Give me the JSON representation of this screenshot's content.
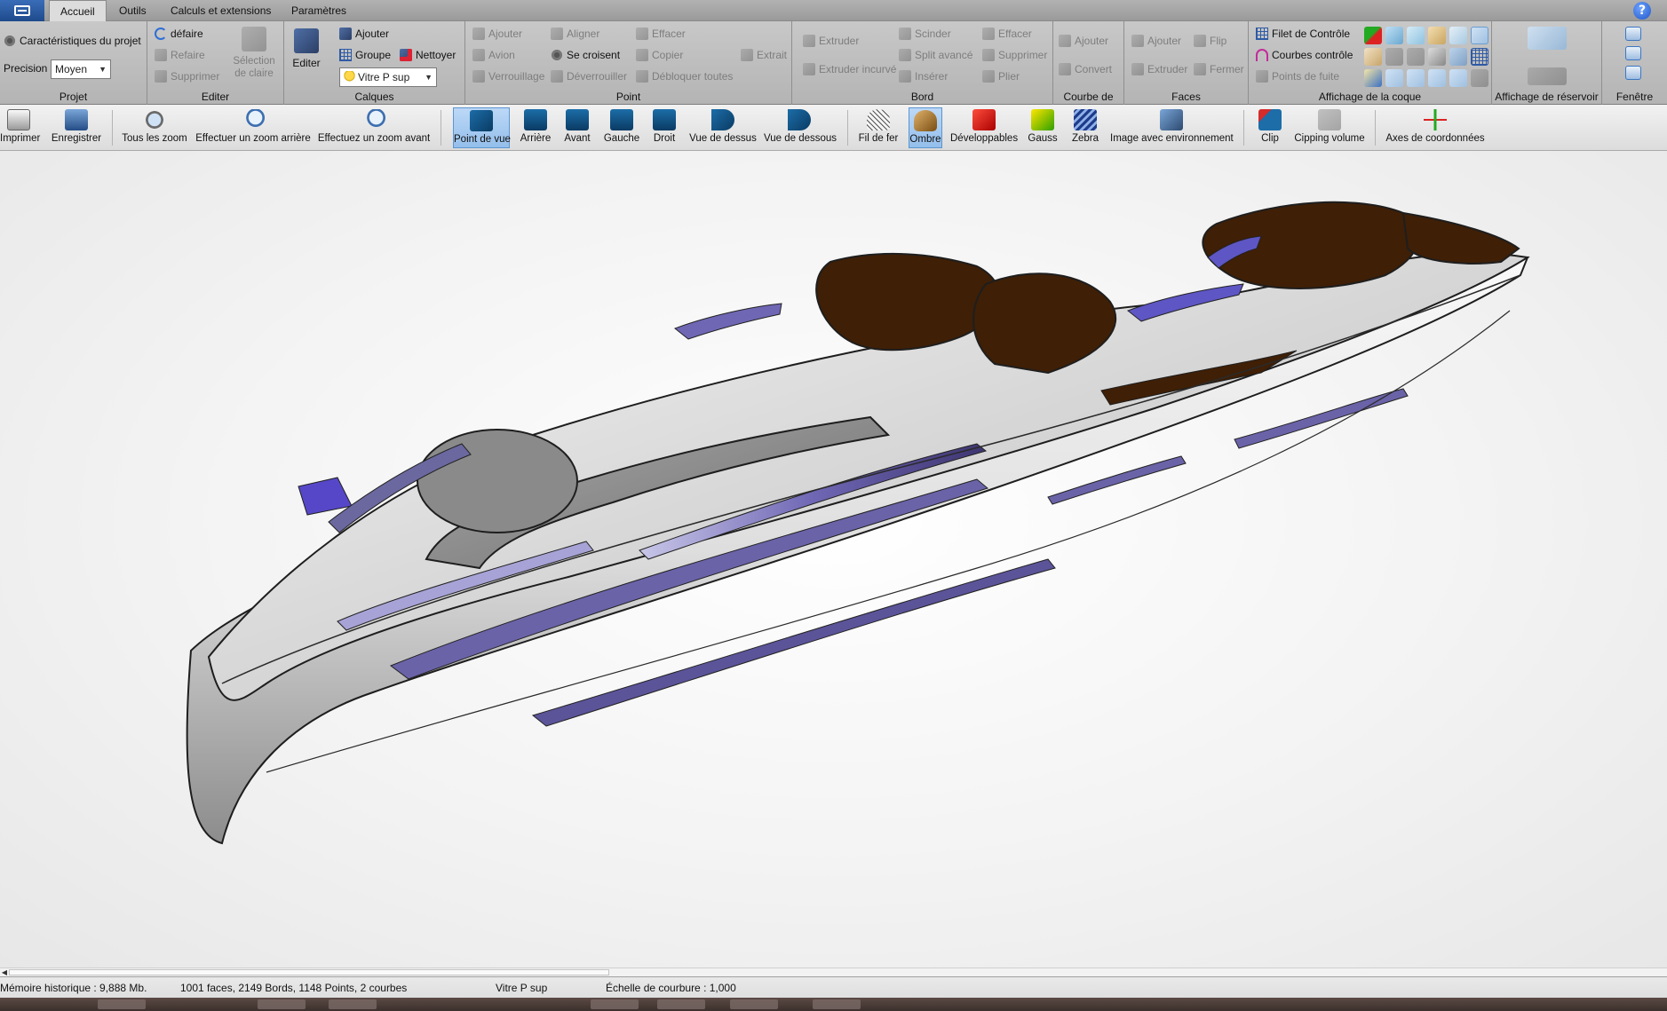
{
  "tabs": [
    "Accueil",
    "Outils",
    "Calculs et extensions",
    "Paramètres"
  ],
  "ribbon": {
    "projet": {
      "title": "Projet",
      "characteristics": "Caractéristiques du projet",
      "precision_label": "Precision",
      "precision_value": "Moyen"
    },
    "editer": {
      "title": "Editer",
      "undo": "défaire",
      "redo": "Refaire",
      "delete": "Supprimer",
      "selection": "Sélection de claire"
    },
    "calques": {
      "title": "Calques",
      "editer": "Editer",
      "ajouter": "Ajouter",
      "groupe": "Groupe",
      "nettoyer": "Nettoyer",
      "layer_value": "Vitre P sup"
    },
    "point": {
      "title": "Point",
      "ajouter": "Ajouter",
      "avion": "Avion",
      "verrouillage": "Verrouillage",
      "aligner": "Aligner",
      "se_croisent": "Se croisent",
      "deverrouiller": "Déverrouiller",
      "effacer": "Effacer",
      "copier": "Copier",
      "debloquer": "Débloquer toutes",
      "extrait": "Extrait"
    },
    "bord": {
      "title": "Bord",
      "extruder": "Extruder",
      "extruder_incurve": "Extruder incurvé",
      "scinder": "Scinder",
      "split_avance": "Split avancé",
      "inserer": "Insérer",
      "effacer": "Effacer",
      "supprimer": "Supprimer",
      "plier": "Plier"
    },
    "courbe": {
      "title": "Courbe de",
      "ajouter": "Ajouter",
      "convert": "Convert"
    },
    "faces": {
      "title": "Faces",
      "ajouter": "Ajouter",
      "extruder": "Extruder",
      "flip": "Flip",
      "fermer": "Fermer"
    },
    "affichage_coque": {
      "title": "Affichage de la coque",
      "filet": "Filet de Contrôle",
      "courbes": "Courbes  contrôle",
      "points": "Points de fuite"
    },
    "affichage_reservoir": {
      "title": "Affichage de réservoir"
    },
    "fenetre": {
      "title": "Fenêtre"
    }
  },
  "toolbar": [
    "Imprimer",
    "Enregistrer",
    "Tous les zoom",
    "Effectuer un zoom arrière",
    "Effectuez un zoom avant",
    "Point de vue",
    "Arrière",
    "Avant",
    "Gauche",
    "Droit",
    "Vue de dessus",
    "Vue de dessous",
    "Fil de fer",
    "Ombre",
    "Développables",
    "Gauss",
    "Zebra",
    "Image avec environnement",
    "Clip",
    "Cipping volume",
    "Axes de coordonnées"
  ],
  "status": {
    "memory": "Mémoire historique : 9,888 Mb.",
    "stats": "1001 faces, 2149 Bords, 1148 Points, 2 courbes",
    "layer": "Vitre P sup",
    "scale": "Échelle de courbure : 1,000"
  },
  "colors": {
    "deck_wood": "#3f1f06",
    "glass": "#5a4fb8",
    "hull": "#e8e8e8",
    "active_blue": "#94bfeb"
  }
}
